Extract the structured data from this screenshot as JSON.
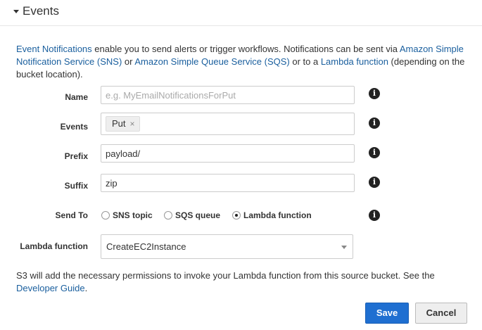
{
  "section": {
    "title": "Events"
  },
  "intro": {
    "link_event_notifications": "Event Notifications",
    "text_1": " enable you to send alerts or trigger workflows. Notifications can be sent via ",
    "link_sns": "Amazon Simple Notification Service (SNS)",
    "text_2": " or ",
    "link_sqs": "Amazon Simple Queue Service (SQS)",
    "text_3": " or to a ",
    "link_lambda": "Lambda function",
    "text_4": " (depending on the bucket location)."
  },
  "form": {
    "name": {
      "label": "Name",
      "value": "",
      "placeholder": "e.g. MyEmailNotificationsForPut"
    },
    "events": {
      "label": "Events",
      "tags": [
        "Put"
      ],
      "remove_symbol": "×"
    },
    "prefix": {
      "label": "Prefix",
      "value": "payload/"
    },
    "suffix": {
      "label": "Suffix",
      "value": "zip"
    },
    "send_to": {
      "label": "Send To",
      "options": [
        "SNS topic",
        "SQS queue",
        "Lambda function"
      ],
      "selected": "Lambda function"
    },
    "lambda_function": {
      "label": "Lambda function",
      "value": "CreateEC2Instance"
    },
    "info_icon_glyph": "i"
  },
  "footer": {
    "text": "S3 will add the necessary permissions to invoke your Lambda function from this source bucket. See the ",
    "link_guide": "Developer Guide",
    "text_end": "."
  },
  "buttons": {
    "save": "Save",
    "cancel": "Cancel"
  },
  "colors": {
    "link": "#1a5f9e",
    "primary_button": "#1f6fd1"
  }
}
